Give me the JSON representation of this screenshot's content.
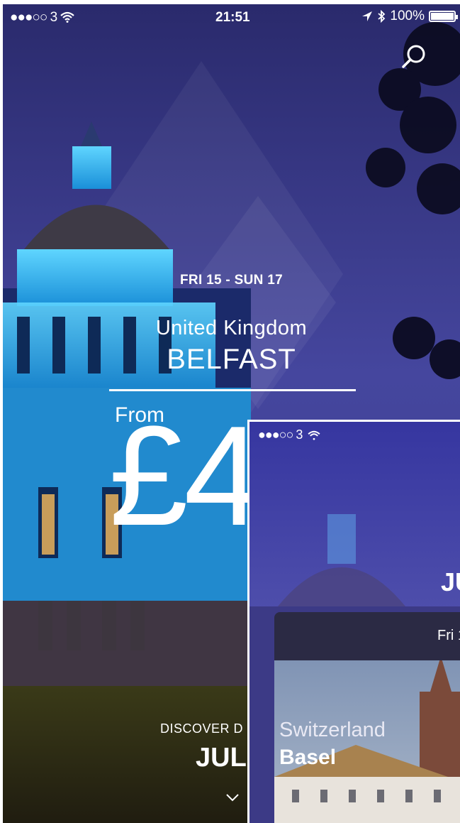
{
  "status_bar": {
    "signal": "●●●○○ 3",
    "time": "21:51",
    "battery": "100%"
  },
  "hero": {
    "dates": "FRI 15 - SUN 17",
    "country": "United Kingdom",
    "city": "BELFAST",
    "from_label": "From",
    "price": "£4"
  },
  "discover": {
    "label": "DISCOVER D",
    "month": "JUL"
  },
  "inset": {
    "status_signal": "●●●○○ 3",
    "month": "JU",
    "card_date": "Fri 1",
    "country": "Switzerland",
    "city": "Basel"
  },
  "colors": {
    "sky_top": "#2a2a6e",
    "sky_mid": "#4d4fa8",
    "building_glow": "#27b9ff"
  }
}
